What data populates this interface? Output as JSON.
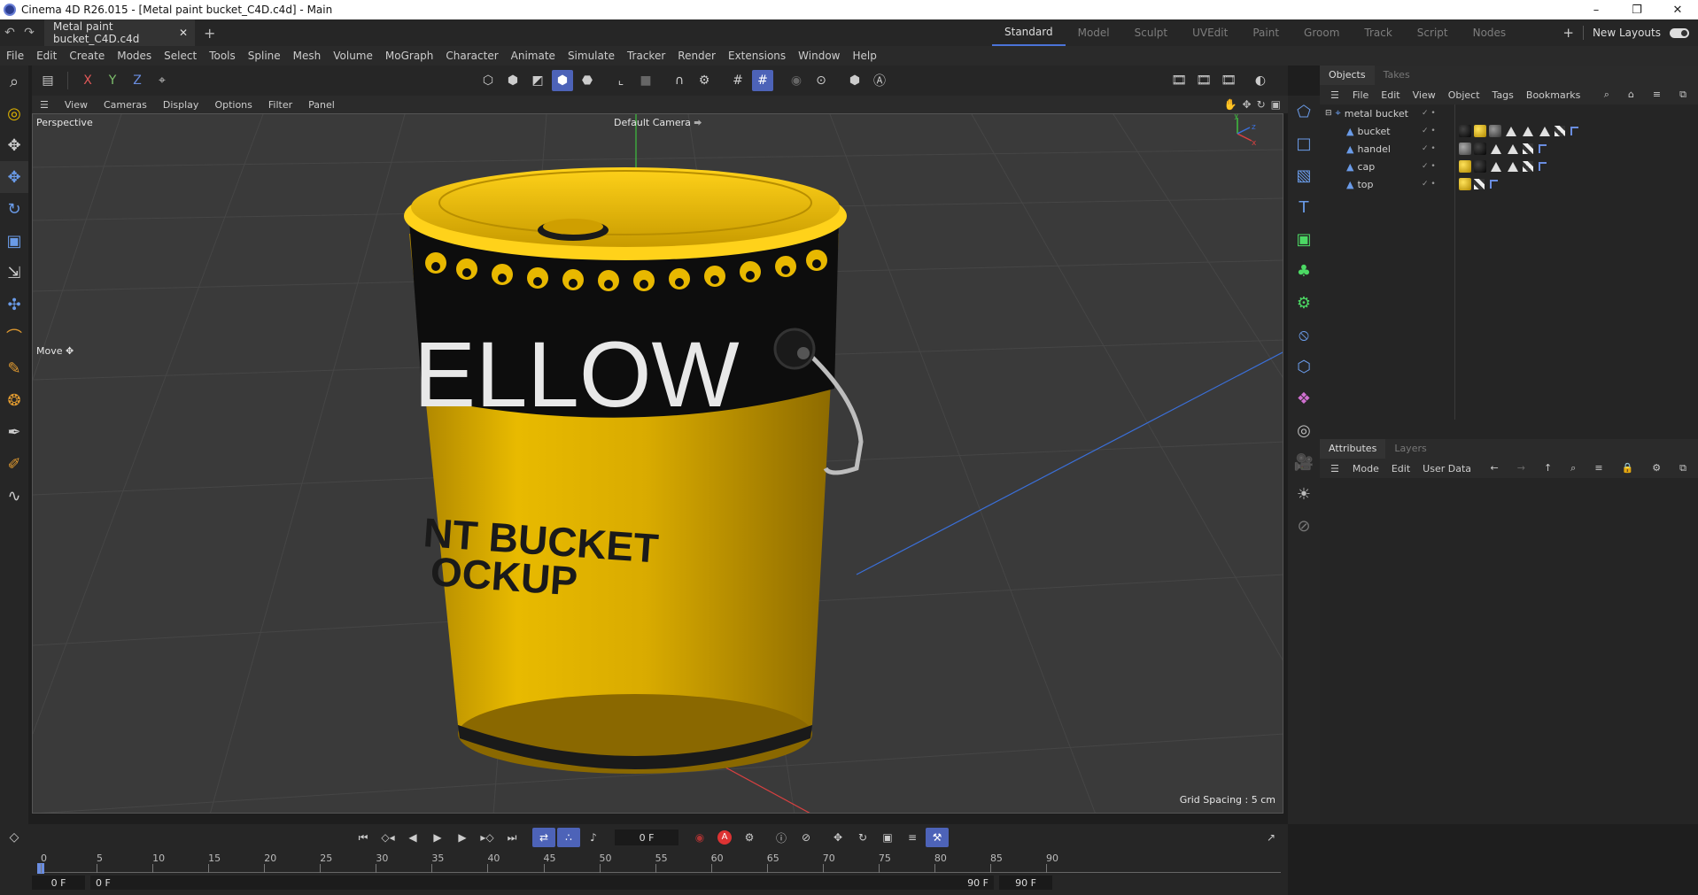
{
  "titlebar": {
    "title": "Cinema 4D R26.015 - [Metal paint bucket_C4D.c4d] - Main",
    "minimize": "–",
    "maximize": "❐",
    "close": "✕"
  },
  "tabbar": {
    "doc_tab": "Metal paint bucket_C4D.c4d",
    "layouts": [
      "Standard",
      "Model",
      "Sculpt",
      "UVEdit",
      "Paint",
      "Groom",
      "Track",
      "Script",
      "Nodes"
    ],
    "active_layout": "Standard",
    "new_layouts": "New Layouts"
  },
  "menubar": [
    "File",
    "Edit",
    "Create",
    "Modes",
    "Select",
    "Tools",
    "Spline",
    "Mesh",
    "Volume",
    "MoGraph",
    "Character",
    "Animate",
    "Simulate",
    "Tracker",
    "Render",
    "Extensions",
    "Window",
    "Help"
  ],
  "vp_toolbar": {
    "axis_x": "X",
    "axis_y": "Y",
    "axis_z": "Z"
  },
  "viewport_menu": [
    "View",
    "Cameras",
    "Display",
    "Options",
    "Filter",
    "Panel"
  ],
  "viewport": {
    "view_name": "Perspective",
    "camera": "Default Camera",
    "tool_label": "Move",
    "grid_spacing": "Grid Spacing : 5 cm",
    "bucket_text_1": "ELLOW",
    "bucket_text_2": "NT BUCKET",
    "bucket_text_3": "OCKUP"
  },
  "objects_panel": {
    "tabs": [
      "Objects",
      "Takes"
    ],
    "menu": [
      "File",
      "Edit",
      "View",
      "Object",
      "Tags",
      "Bookmarks"
    ],
    "objects": [
      {
        "name": "metal bucket",
        "level": 0
      },
      {
        "name": "bucket",
        "level": 1
      },
      {
        "name": "handel",
        "level": 1
      },
      {
        "name": "cap",
        "level": 1
      },
      {
        "name": "top",
        "level": 1
      }
    ]
  },
  "attributes_panel": {
    "tabs": [
      "Attributes",
      "Layers"
    ],
    "menu": [
      "Mode",
      "Edit",
      "User Data"
    ]
  },
  "timeline": {
    "current_frame": "0 F",
    "ruler_ticks": [
      "0",
      "5",
      "10",
      "15",
      "20",
      "25",
      "30",
      "35",
      "40",
      "45",
      "50",
      "55",
      "60",
      "65",
      "70",
      "75",
      "80",
      "85",
      "90"
    ],
    "start_frame": "0 F",
    "range_start": "0 F",
    "range_end": "90 F",
    "end_frame": "90 F",
    "rec_label": "A"
  },
  "colors": {
    "accent": "#4d63b8",
    "bucket_yellow": "#e0b400",
    "viewport_bg": "#3a3a3a"
  }
}
